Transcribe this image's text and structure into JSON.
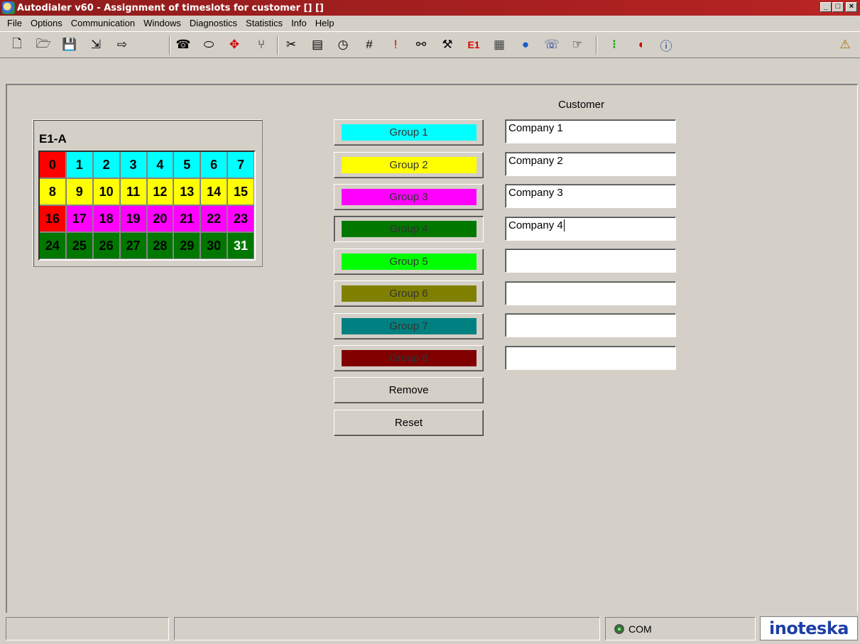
{
  "window": {
    "title": "Autodialer v60 - Assignment of timeslots for customer [] []",
    "min_glyph": "_",
    "max_glyph": "□",
    "close_glyph": "×"
  },
  "menu": [
    {
      "label": "File"
    },
    {
      "label": "Options"
    },
    {
      "label": "Communication"
    },
    {
      "label": "Windows"
    },
    {
      "label": "Diagnostics"
    },
    {
      "label": "Statistics"
    },
    {
      "label": "Info"
    },
    {
      "label": "Help"
    }
  ],
  "toolbar": {
    "icons": [
      {
        "name": "new-document-icon",
        "glyph": "🗋"
      },
      {
        "name": "open-folder-icon",
        "glyph": "🗁"
      },
      {
        "name": "save-icon",
        "glyph": "💾"
      },
      {
        "name": "import-icon",
        "glyph": "⇲"
      },
      {
        "name": "export-icon",
        "glyph": "⇨"
      },
      {
        "name": "phone-icon",
        "glyph": "☎"
      },
      {
        "name": "chip-icon",
        "glyph": "⬭"
      },
      {
        "name": "move-icon",
        "glyph": "✥"
      },
      {
        "name": "connector-icon",
        "glyph": "⑂"
      },
      {
        "name": "cut-icon",
        "glyph": "✂"
      },
      {
        "name": "document-list-icon",
        "glyph": "▤"
      },
      {
        "name": "timer-icon",
        "glyph": "◷"
      },
      {
        "name": "number-icon",
        "glyph": "#"
      },
      {
        "name": "alert-icon",
        "glyph": "!"
      },
      {
        "name": "link-icon",
        "glyph": "⚯"
      },
      {
        "name": "tools-icon",
        "glyph": "⚒"
      },
      {
        "name": "e1-icon",
        "glyph": "E1"
      },
      {
        "name": "calendar-icon",
        "glyph": "▦"
      },
      {
        "name": "globe-icon",
        "glyph": "●"
      },
      {
        "name": "cli-phone-icon",
        "glyph": "☏"
      },
      {
        "name": "pointer-icon",
        "glyph": "☞"
      },
      {
        "name": "traffic-light-icon",
        "glyph": "⁝"
      },
      {
        "name": "sound-icon",
        "glyph": "◖"
      },
      {
        "name": "info-icon",
        "glyph": "ⓘ"
      },
      {
        "name": "help-icon",
        "glyph": "⚠"
      }
    ]
  },
  "e1": {
    "label": "E1-A",
    "timeslots": [
      {
        "n": "0",
        "bg": "#ff0000",
        "fg": "#000000"
      },
      {
        "n": "1",
        "bg": "#00ffff",
        "fg": "#000000"
      },
      {
        "n": "2",
        "bg": "#00ffff",
        "fg": "#000000"
      },
      {
        "n": "3",
        "bg": "#00ffff",
        "fg": "#000000"
      },
      {
        "n": "4",
        "bg": "#00ffff",
        "fg": "#000000"
      },
      {
        "n": "5",
        "bg": "#00ffff",
        "fg": "#000000"
      },
      {
        "n": "6",
        "bg": "#00ffff",
        "fg": "#000000"
      },
      {
        "n": "7",
        "bg": "#00ffff",
        "fg": "#000000"
      },
      {
        "n": "8",
        "bg": "#ffff00",
        "fg": "#000000"
      },
      {
        "n": "9",
        "bg": "#ffff00",
        "fg": "#000000"
      },
      {
        "n": "10",
        "bg": "#ffff00",
        "fg": "#000000"
      },
      {
        "n": "11",
        "bg": "#ffff00",
        "fg": "#000000"
      },
      {
        "n": "12",
        "bg": "#ffff00",
        "fg": "#000000"
      },
      {
        "n": "13",
        "bg": "#ffff00",
        "fg": "#000000"
      },
      {
        "n": "14",
        "bg": "#ffff00",
        "fg": "#000000"
      },
      {
        "n": "15",
        "bg": "#ffff00",
        "fg": "#000000"
      },
      {
        "n": "16",
        "bg": "#ff0000",
        "fg": "#000000"
      },
      {
        "n": "17",
        "bg": "#ff00ff",
        "fg": "#000000"
      },
      {
        "n": "18",
        "bg": "#ff00ff",
        "fg": "#000000"
      },
      {
        "n": "19",
        "bg": "#ff00ff",
        "fg": "#000000"
      },
      {
        "n": "20",
        "bg": "#ff00ff",
        "fg": "#000000"
      },
      {
        "n": "21",
        "bg": "#ff00ff",
        "fg": "#000000"
      },
      {
        "n": "22",
        "bg": "#ff00ff",
        "fg": "#000000"
      },
      {
        "n": "23",
        "bg": "#ff00ff",
        "fg": "#000000"
      },
      {
        "n": "24",
        "bg": "#007800",
        "fg": "#000000"
      },
      {
        "n": "25",
        "bg": "#007800",
        "fg": "#000000"
      },
      {
        "n": "26",
        "bg": "#007800",
        "fg": "#000000"
      },
      {
        "n": "27",
        "bg": "#007800",
        "fg": "#000000"
      },
      {
        "n": "28",
        "bg": "#007800",
        "fg": "#000000"
      },
      {
        "n": "29",
        "bg": "#007800",
        "fg": "#000000"
      },
      {
        "n": "30",
        "bg": "#007800",
        "fg": "#000000"
      },
      {
        "n": "31",
        "bg": "#007800",
        "fg": "#ffffff"
      }
    ]
  },
  "customer_header": "Customer",
  "groups": [
    {
      "label": "Group 1",
      "color": "#00ffff",
      "customer": "Company 1"
    },
    {
      "label": "Group 2",
      "color": "#ffff00",
      "customer": "Company 2"
    },
    {
      "label": "Group 3",
      "color": "#ff00ff",
      "customer": "Company 3"
    },
    {
      "label": "Group 4",
      "color": "#007800",
      "customer": "Company 4"
    },
    {
      "label": "Group 5",
      "color": "#00ff00",
      "customer": ""
    },
    {
      "label": "Group 6",
      "color": "#808000",
      "customer": ""
    },
    {
      "label": "Group 7",
      "color": "#008080",
      "customer": ""
    },
    {
      "label": "Group 8",
      "color": "#800000",
      "customer": ""
    }
  ],
  "actions": {
    "remove_label": "Remove",
    "reset_label": "Reset"
  },
  "status": {
    "com_label": "COM",
    "brand": "inoteska"
  }
}
